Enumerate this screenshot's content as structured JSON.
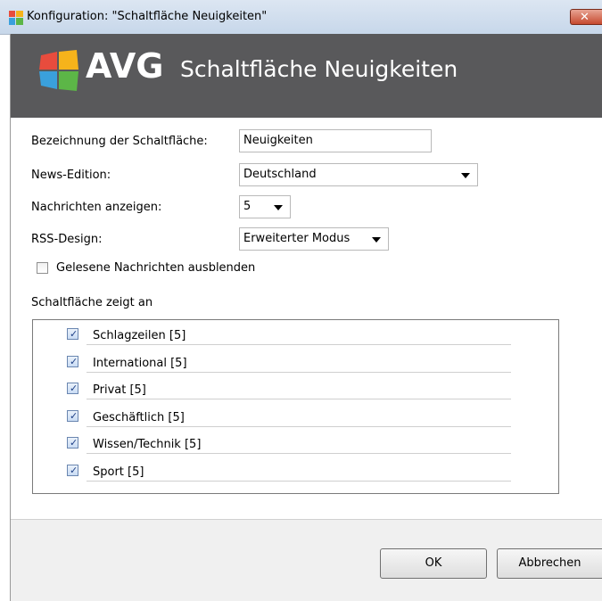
{
  "window": {
    "title": "Konfiguration: \"Schaltfläche Neuigkeiten\"",
    "close_label": "✕"
  },
  "banner": {
    "brand": "AVG",
    "title": "Schaltfläche Neuigkeiten"
  },
  "form": {
    "button_name_label": "Bezeichnung der Schaltfläche:",
    "button_name_value": "Neuigkeiten",
    "edition_label": "News-Edition:",
    "edition_value": "Deutschland",
    "count_label": "Nachrichten anzeigen:",
    "count_value": "5",
    "design_label": "RSS-Design:",
    "design_value": "Erweiterter Modus",
    "hide_read_label": "Gelesene Nachrichten ausblenden",
    "hide_read_checked": false
  },
  "group": {
    "label": "Schaltfläche zeigt an",
    "items": [
      {
        "label": "Schlagzeilen [5]",
        "checked": true
      },
      {
        "label": "International [5]",
        "checked": true
      },
      {
        "label": "Privat [5]",
        "checked": true
      },
      {
        "label": "Geschäftlich [5]",
        "checked": true
      },
      {
        "label": "Wissen/Technik [5]",
        "checked": true
      },
      {
        "label": "Sport [5]",
        "checked": true
      }
    ]
  },
  "buttons": {
    "ok": "OK",
    "cancel": "Abbrechen"
  },
  "colors": {
    "banner_bg": "#59595b",
    "titlebar_bg": "#c7d7ea",
    "close_bg": "#c64a2f",
    "checkbox_mark": "#1e3f86"
  }
}
